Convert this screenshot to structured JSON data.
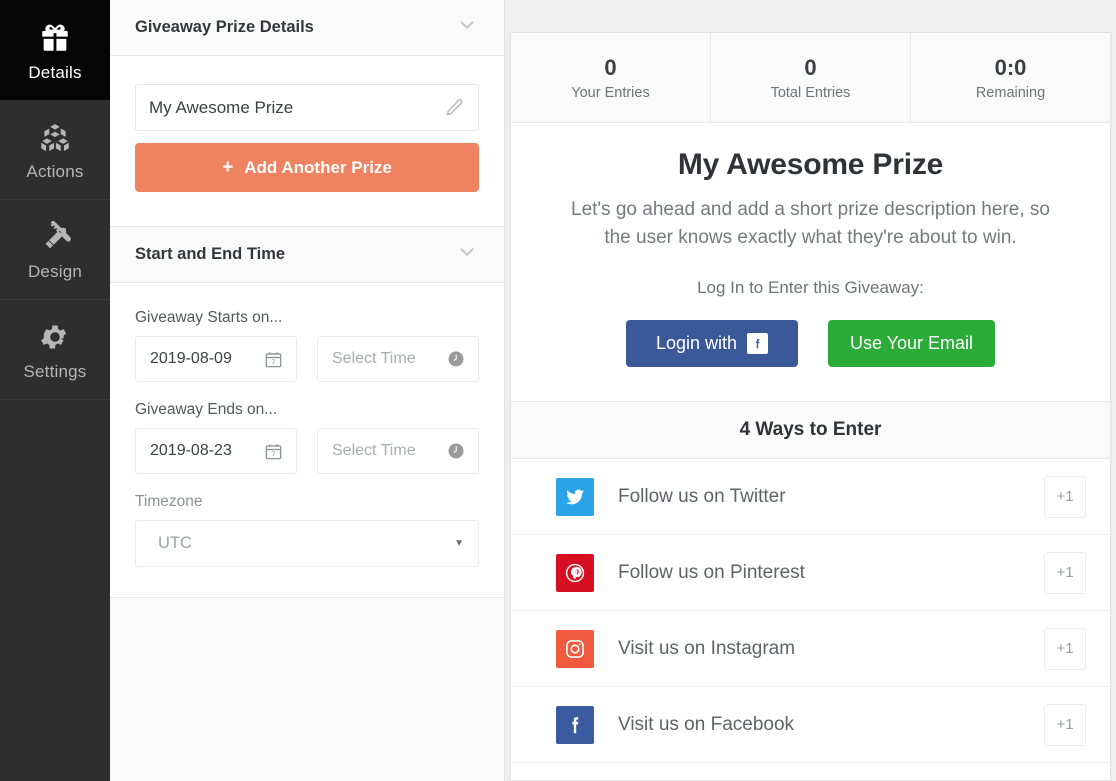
{
  "sidebar": {
    "items": [
      {
        "label": "Details",
        "icon": "gift-icon",
        "active": true
      },
      {
        "label": "Actions",
        "icon": "cubes-icon",
        "active": false
      },
      {
        "label": "Design",
        "icon": "pencil-ruler-icon",
        "active": false
      },
      {
        "label": "Settings",
        "icon": "gear-icon",
        "active": false
      }
    ]
  },
  "editor": {
    "prize_section": {
      "title": "Giveaway Prize Details",
      "collapse_icon": "chevron-down-icon",
      "prize_name": "My Awesome Prize",
      "prize_edit_icon": "pencil-icon",
      "add_prize_label": "Add Another Prize",
      "add_prize_icon": "plus-icon"
    },
    "time_section": {
      "title": "Start and End Time",
      "collapse_icon": "chevron-down-icon",
      "start_label": "Giveaway Starts on...",
      "start_date": "2019-08-09",
      "start_time_placeholder": "Select Time",
      "end_label": "Giveaway Ends on...",
      "end_date": "2019-08-23",
      "end_time_placeholder": "Select Time",
      "timezone_label": "Timezone",
      "timezone_value": "UTC",
      "calendar_icon": "calendar-icon",
      "clock_icon": "clock-icon",
      "select_caret_icon": "caret-down-icon"
    }
  },
  "preview": {
    "stats": [
      {
        "value": "0",
        "label": "Your Entries"
      },
      {
        "value": "0",
        "label": "Total Entries"
      },
      {
        "value": "0:0",
        "label": "Remaining"
      }
    ],
    "hero": {
      "title": "My Awesome Prize",
      "description": "Let's go ahead and add a short prize description here, so the user knows exactly what they're about to win."
    },
    "login": {
      "prompt": "Log In to Enter this Giveaway:",
      "facebook_label": "Login with",
      "facebook_icon": "facebook-icon",
      "email_label": "Use Your Email"
    },
    "ways": {
      "heading": "4 Ways to Enter",
      "entries": [
        {
          "label": "Follow us on Twitter",
          "points": "+1",
          "icon": "twitter-icon",
          "color": "#2ba3e8"
        },
        {
          "label": "Follow us on Pinterest",
          "points": "+1",
          "icon": "pinterest-icon",
          "color": "#d60e21"
        },
        {
          "label": "Visit us on Instagram",
          "points": "+1",
          "icon": "instagram-icon",
          "color": "#f05a3c"
        },
        {
          "label": "Visit us on Facebook",
          "points": "+1",
          "icon": "facebook-icon",
          "color": "#3a5ba0"
        }
      ]
    }
  },
  "colors": {
    "accent_orange": "#ef8361",
    "facebook_blue": "#3b5998",
    "email_green": "#2bab37",
    "sidebar_bg": "#2e2e2e",
    "sidebar_active_bg": "#050505"
  }
}
